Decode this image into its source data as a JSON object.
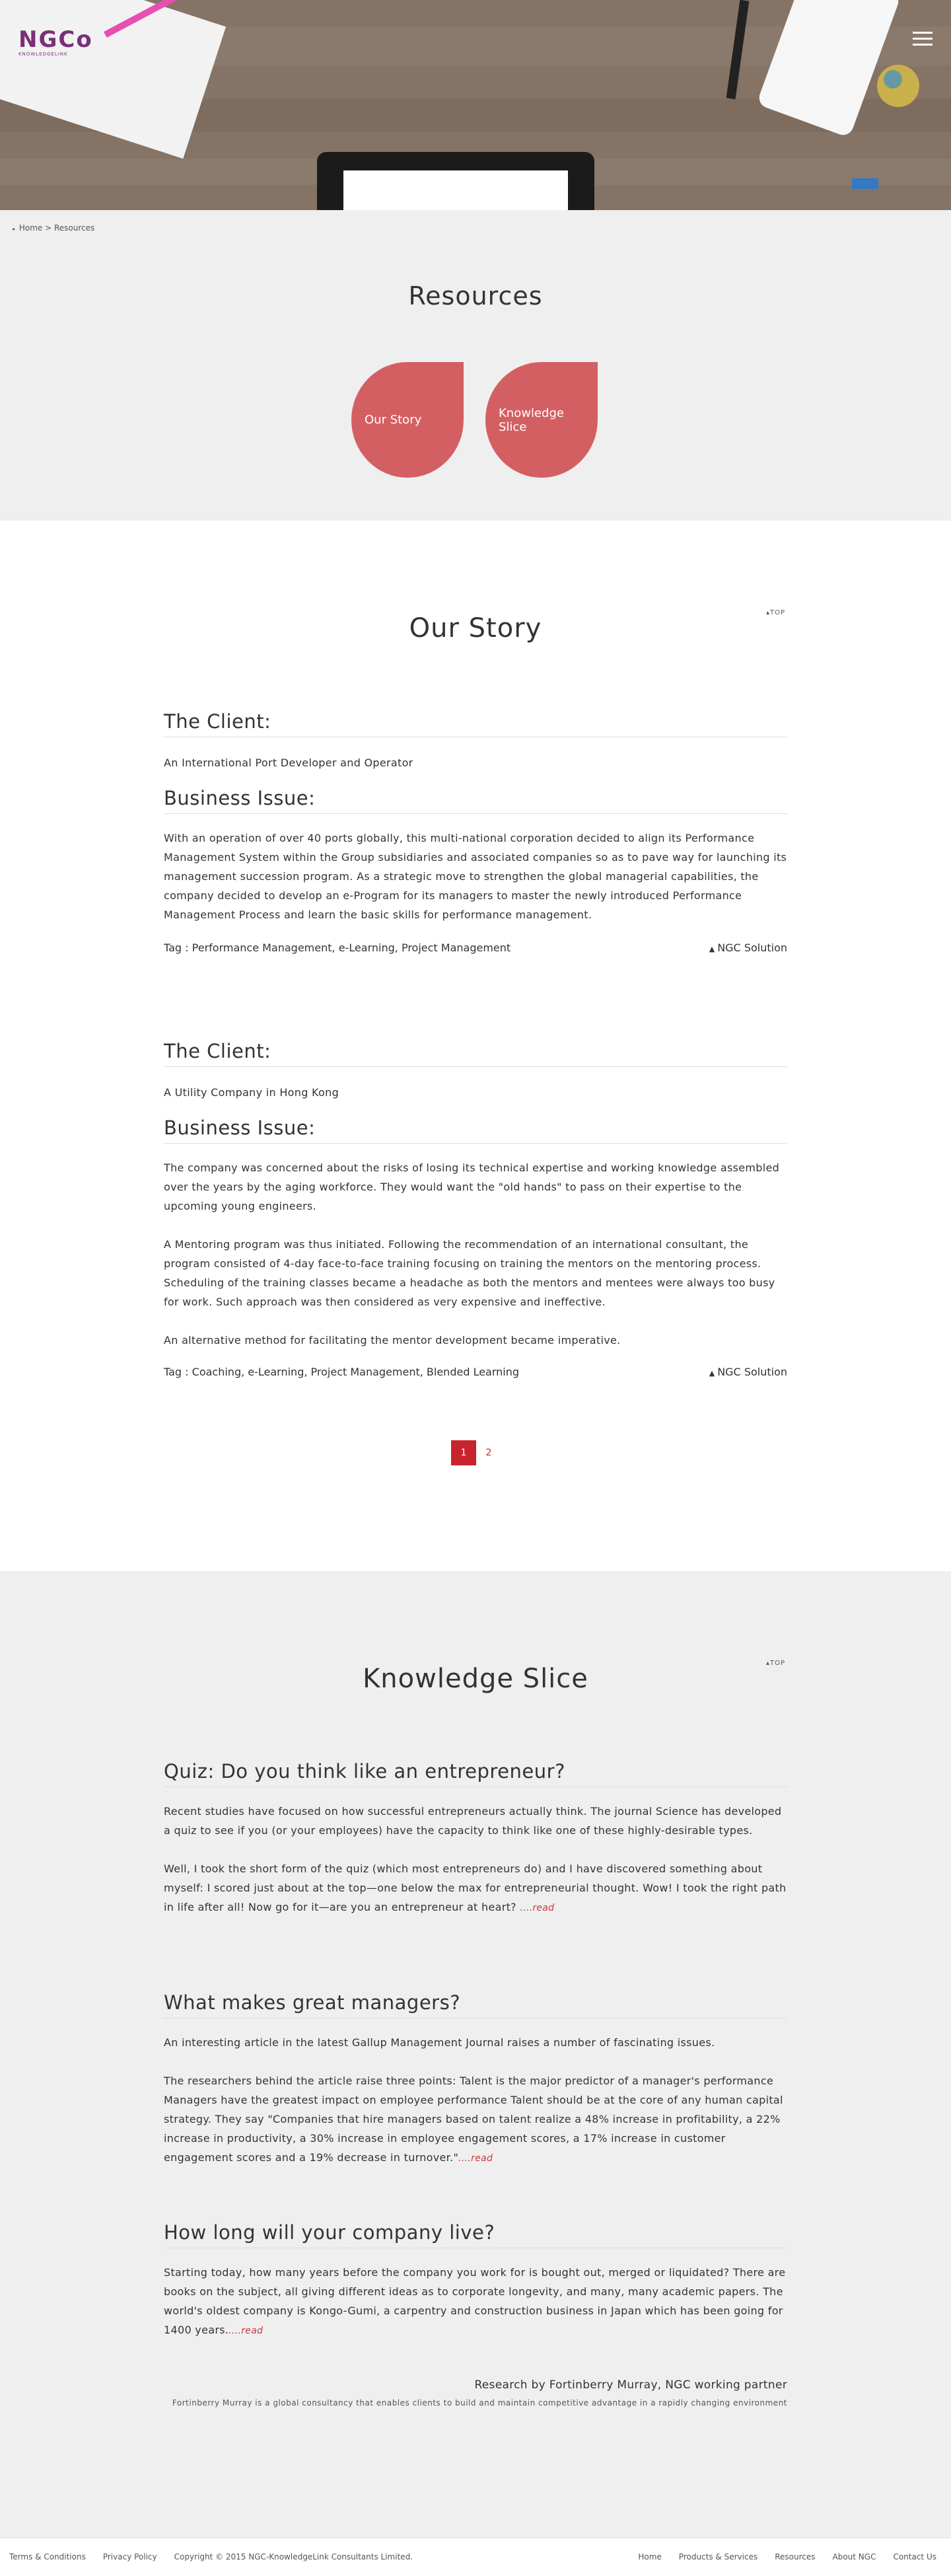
{
  "header": {
    "logo_text": "NGCo",
    "logo_sub": "KNOWLEDGELINK"
  },
  "breadcrumb": {
    "home": "Home",
    "separator": ">",
    "current": "Resources"
  },
  "resources": {
    "title": "Resources",
    "cards": [
      "Our Story",
      "Knowledge\nSlice"
    ]
  },
  "our_story": {
    "title": "Our Story",
    "top_link": "TOP",
    "cases": [
      {
        "client_heading": "The Client:",
        "client": "An International Port Developer and Operator",
        "issue_heading": "Business Issue:",
        "paragraphs": [
          "With an operation of over 40 ports globally, this multi-national corporation decided to align its Performance Management System within the Group subsidiaries and associated companies so as to pave way for launching its management succession program. As a strategic move to strengthen the global managerial capabilities, the company decided to develop an e-Program for its managers to master the newly introduced Performance Management Process and learn the basic skills for performance management."
        ],
        "tags": "Tag : Performance Management, e-Learning, Project Management",
        "solution": "NGC Solution"
      },
      {
        "client_heading": "The Client:",
        "client": "A Utility Company in Hong Kong",
        "issue_heading": "Business Issue:",
        "paragraphs": [
          "The company was concerned about the risks of losing its technical expertise and working knowledge assembled over the years by the aging workforce. They would want the \"old hands\" to pass on their expertise to the upcoming young engineers.",
          "A Mentoring program was thus initiated. Following the recommendation of an international consultant, the program consisted of 4-day face-to-face training focusing on training the mentors on the mentoring process. Scheduling of the training classes became a headache as both the mentors and mentees were always too busy for work. Such approach was then considered as very expensive and ineffective.",
          "An alternative method for facilitating the mentor development became imperative."
        ],
        "tags": "Tag : Coaching, e-Learning, Project Management, Blended Learning",
        "solution": "NGC Solution"
      }
    ],
    "pages": [
      "1",
      "2"
    ]
  },
  "knowledge": {
    "title": "Knowledge Slice",
    "top_link": "TOP",
    "articles": [
      {
        "heading": "Quiz: Do you think like an entrepreneur?",
        "paragraphs": [
          "Recent studies have focused on how successful entrepreneurs actually think. The journal Science has developed a quiz to see if you (or your employees) have the capacity to think like one of these highly-desirable types.",
          "Well, I took the short form of the quiz (which most entrepreneurs do) and I have discovered something about myself: I scored just about at the top—one below the max for entrepreneurial thought. Wow! I took the right path in life after all! Now go for it—are you an entrepreneur at heart? "
        ],
        "read": "....read"
      },
      {
        "heading": "What makes great managers?",
        "paragraphs": [
          "An interesting article in the latest Gallup Management Journal raises a number of fascinating issues.",
          "The researchers behind the article raise three points: Talent is the major predictor of a manager's performance Managers have the greatest impact on employee performance Talent should be at the core of any human capital strategy. They say \"Companies that hire managers based on talent realize a 48% increase in profitability, a 22% increase in productivity, a 30% increase in employee engagement scores, a 17% increase in customer engagement scores and a 19% decrease in turnover.\""
        ],
        "read": "....read"
      },
      {
        "heading": "How long will your company live?",
        "paragraphs": [
          "Starting today, how many years before the company you work for is bought out, merged or liquidated? There are books on the subject, all giving different ideas as to corporate longevity, and many, many academic papers. The world's oldest company is Kongo-Gumi, a carpentry and construction business in Japan which has been going for 1400 years."
        ],
        "read": "....read"
      }
    ],
    "credit": "Research by Fortinberry Murray, NGC working partner",
    "credit_sub": "Fortinberry Murray is a global consultancy that enables clients to build and maintain competitive advantage in a rapidly changing environment"
  },
  "footer": {
    "left": [
      "Terms & Conditions",
      "Privacy Policy",
      "Copyright © 2015 NGC-KnowledgeLink Consultants Limited."
    ],
    "right": [
      "Home",
      "Products & Services",
      "Resources",
      "About NGC",
      "Contact Us"
    ]
  },
  "colors": {
    "accent": "#c8242b",
    "drop": "#d45f63",
    "logo": "#7a2f7a",
    "section_gray": "#efefef"
  }
}
